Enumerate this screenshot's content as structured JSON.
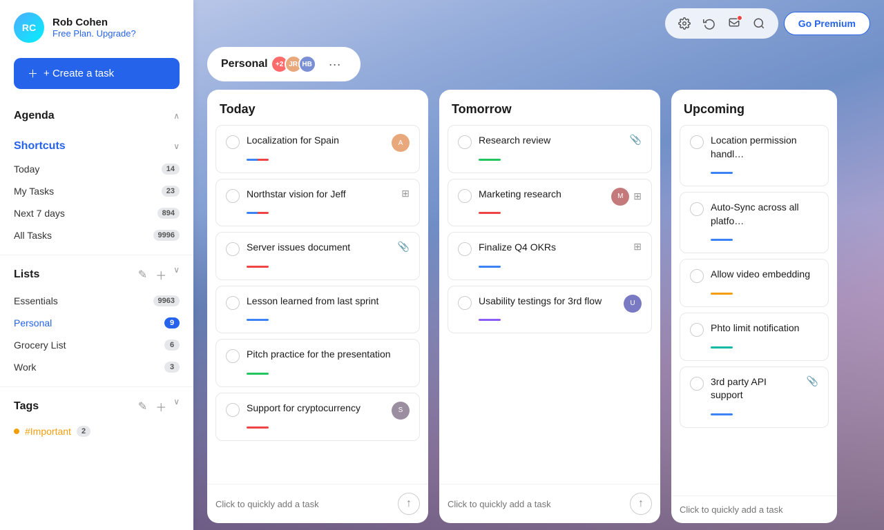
{
  "sidebar": {
    "user": {
      "name": "Rob Cohen",
      "plan": "Free Plan.",
      "upgrade_label": "Upgrade?"
    },
    "create_task_label": "+ Create a task",
    "agenda": {
      "title": "Agenda",
      "expanded": true
    },
    "shortcuts": {
      "title": "Shortcuts",
      "expanded": true,
      "items": [
        {
          "label": "Today",
          "badge": "14",
          "active": false
        },
        {
          "label": "My Tasks",
          "badge": "23",
          "active": false
        },
        {
          "label": "Next 7 days",
          "badge": "894",
          "active": false
        },
        {
          "label": "All Tasks",
          "badge": "9996",
          "active": false
        }
      ]
    },
    "lists": {
      "title": "Lists",
      "expanded": true,
      "items": [
        {
          "label": "Essentials",
          "badge": "9963",
          "active": false
        },
        {
          "label": "Personal",
          "badge": "9",
          "active": true
        },
        {
          "label": "Grocery List",
          "badge": "6",
          "active": false
        },
        {
          "label": "Work",
          "badge": "3",
          "active": false
        }
      ]
    },
    "tags": {
      "title": "Tags",
      "expanded": true,
      "items": [
        {
          "label": "#Important",
          "badge": "2",
          "color": "#f59e0b"
        }
      ]
    }
  },
  "header": {
    "board_name": "Personal",
    "member_count": "+2",
    "go_premium": "Go Premium"
  },
  "columns": [
    {
      "id": "today",
      "title": "Today",
      "tasks": [
        {
          "title": "Localization for Spain",
          "tag": "blue-red",
          "has_avatar": true,
          "avatar_color": "#e8a87c",
          "avatar_initials": "A",
          "has_attachment": false,
          "has_subtask": false
        },
        {
          "title": "Northstar vision for Jeff",
          "tag": "blue-red",
          "has_avatar": false,
          "has_attachment": false,
          "has_subtask": true
        },
        {
          "title": "Server issues document",
          "tag": "red",
          "has_avatar": false,
          "has_attachment": true,
          "has_subtask": false
        },
        {
          "title": "Lesson learned from last sprint",
          "tag": "blue",
          "has_avatar": false,
          "has_attachment": false,
          "has_subtask": false
        },
        {
          "title": "Pitch practice for the presentation",
          "tag": "green",
          "has_avatar": false,
          "has_attachment": false,
          "has_subtask": false
        },
        {
          "title": "Support for cryptocurrency",
          "tag": "red",
          "has_avatar": true,
          "avatar_color": "#9b8ea0",
          "avatar_initials": "S",
          "has_attachment": false,
          "has_subtask": false
        }
      ],
      "quick_add_placeholder": "Click to quickly add a task"
    },
    {
      "id": "tomorrow",
      "title": "Tomorrow",
      "tasks": [
        {
          "title": "Research review",
          "tag": "green",
          "has_avatar": false,
          "has_attachment": true,
          "has_subtask": false
        },
        {
          "title": "Marketing research",
          "tag": "red",
          "has_avatar": true,
          "avatar_color": "#c47a7a",
          "avatar_initials": "M",
          "has_attachment": false,
          "has_subtask": true
        },
        {
          "title": "Finalize Q4 OKRs",
          "tag": "blue",
          "has_avatar": false,
          "has_attachment": false,
          "has_subtask": true
        },
        {
          "title": "Usability testings for 3rd flow",
          "tag": "purple",
          "has_avatar": true,
          "avatar_color": "#7a7ac4",
          "avatar_initials": "U",
          "has_attachment": false,
          "has_subtask": false
        }
      ],
      "quick_add_placeholder": "Click to quickly add a task"
    },
    {
      "id": "upcoming",
      "title": "Upcoming",
      "tasks": [
        {
          "title": "Location permission handl…",
          "tag": "blue",
          "has_avatar": false,
          "has_attachment": false,
          "has_subtask": false
        },
        {
          "title": "Auto-Sync across all platfo…",
          "tag": "blue",
          "has_avatar": false,
          "has_attachment": false,
          "has_subtask": false
        },
        {
          "title": "Allow video embedding",
          "tag": "orange",
          "has_avatar": false,
          "has_attachment": false,
          "has_subtask": false
        },
        {
          "title": "Phto limit notification",
          "tag": "teal",
          "has_avatar": false,
          "has_attachment": false,
          "has_subtask": false
        },
        {
          "title": "3rd party API support",
          "tag": "blue",
          "has_avatar": false,
          "has_attachment": true,
          "has_subtask": false
        }
      ],
      "quick_add_placeholder": "Click to quickly add a task"
    }
  ]
}
